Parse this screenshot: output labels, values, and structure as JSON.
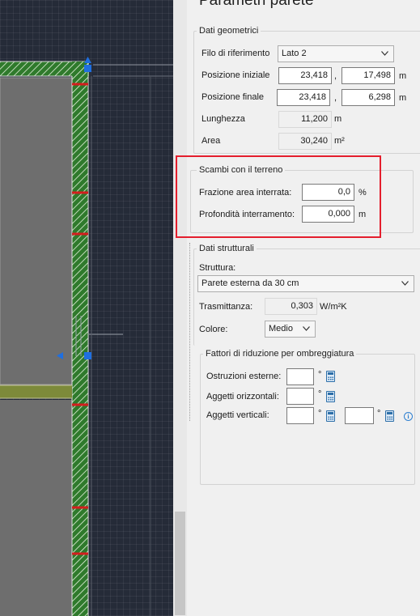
{
  "panel_title": "Parametri parete",
  "colors": {
    "highlight": "#e41e2d",
    "wall_hatch": "#2f7a2c",
    "selection_marker": "#1f6fe0",
    "section_marker": "#d41e1e"
  },
  "geometric": {
    "legend": "Dati geometrici",
    "filo_label": "Filo di riferimento",
    "filo_value": "Lato 2",
    "pos_start_label": "Posizione iniziale",
    "pos_start_x": "23,418",
    "pos_start_y": "17,498",
    "pos_end_label": "Posizione finale",
    "pos_end_x": "23,418",
    "pos_end_y": "6,298",
    "length_label": "Lunghezza",
    "length_value": "11,200",
    "area_label": "Area",
    "area_value": "30,240",
    "unit_m": "m",
    "unit_m2": "m²",
    "comma": ","
  },
  "ground": {
    "legend": "Scambi con il terreno",
    "buried_label": "Frazione area interrata:",
    "buried_value": "0,0",
    "buried_unit": "%",
    "depth_label": "Profondità interramento:",
    "depth_value": "0,000",
    "depth_unit": "m"
  },
  "structural": {
    "legend": "Dati strutturali",
    "structure_label": "Struttura:",
    "structure_value": "Parete esterna da 30 cm",
    "transmittance_label": "Trasmittanza:",
    "transmittance_value": "0,303",
    "transmittance_unit": "W/m²K",
    "color_label": "Colore:",
    "color_value": "Medio"
  },
  "shading": {
    "legend": "Fattori di riduzione per ombreggiatura",
    "external_label": "Ostruzioni esterne:",
    "external_value": "",
    "horizontal_label": "Aggetti orizzontali:",
    "horizontal_value": "",
    "vertical_label": "Aggetti verticali:",
    "vertical_value_1": "",
    "vertical_value_2": "",
    "degree": "°"
  }
}
